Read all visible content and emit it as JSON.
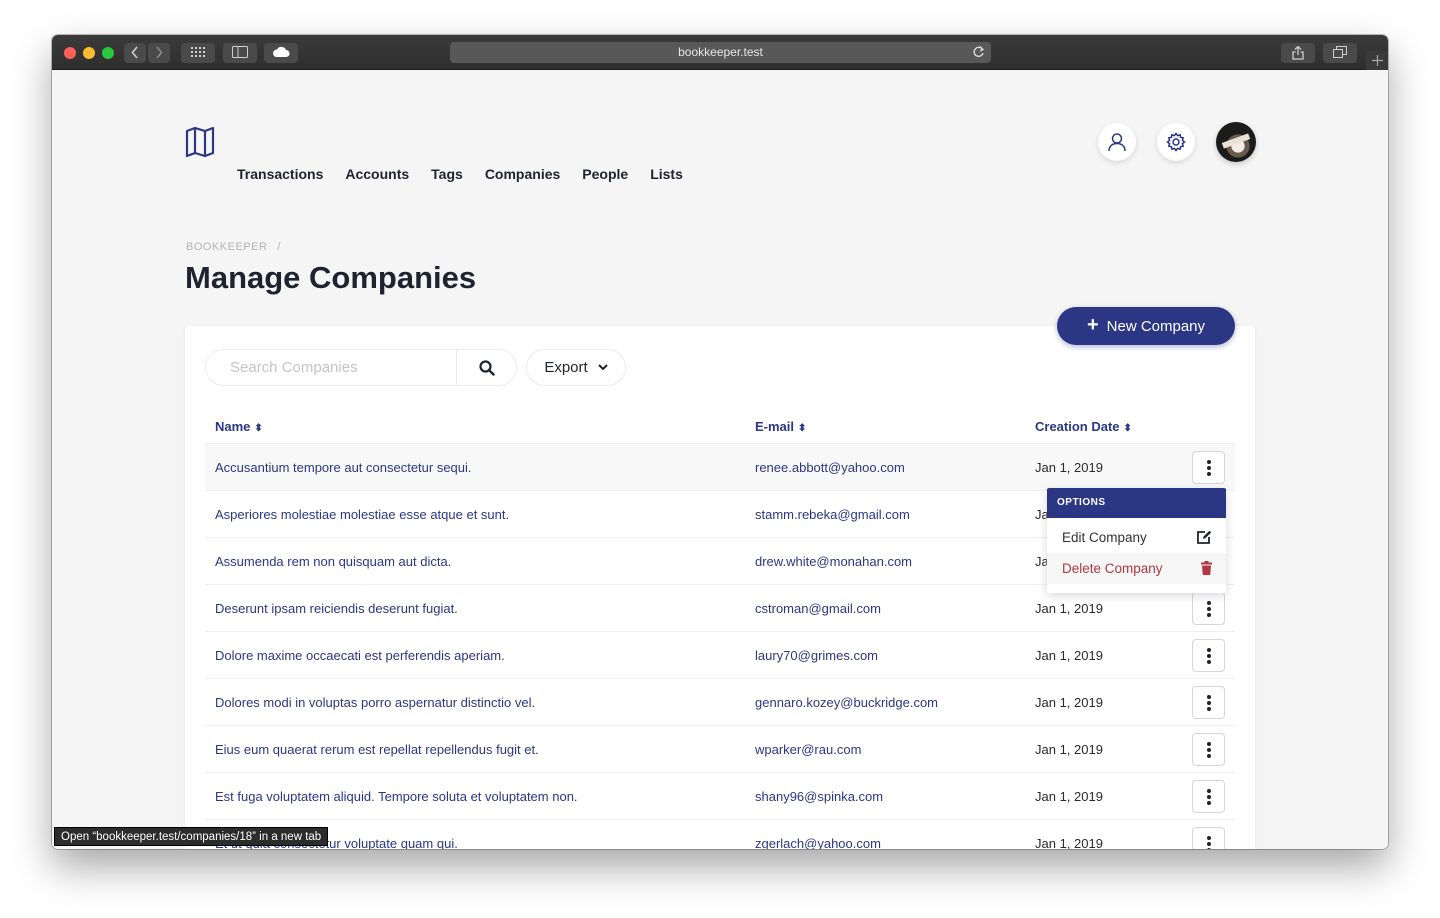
{
  "browser": {
    "url": "bookkeeper.test",
    "status_tip": "Open “bookkeeper.test/companies/18” in a new tab"
  },
  "nav": {
    "items": [
      "Transactions",
      "Accounts",
      "Tags",
      "Companies",
      "People",
      "Lists"
    ]
  },
  "breadcrumb": {
    "root": "BOOKKEEPER",
    "separator": "/"
  },
  "page": {
    "title": "Manage Companies",
    "new_button": "New Company"
  },
  "toolbar": {
    "search_placeholder": "Search Companies",
    "export_label": "Export"
  },
  "table": {
    "headers": {
      "name": "Name",
      "email": "E-mail",
      "created": "Creation Date"
    },
    "rows": [
      {
        "name": "Accusantium tempore aut consectetur sequi.",
        "email": "renee.abbott@yahoo.com",
        "date": "Jan 1, 2019"
      },
      {
        "name": "Asperiores molestiae molestiae esse atque et sunt.",
        "email": "stamm.rebeka@gmail.com",
        "date": "Ja"
      },
      {
        "name": "Assumenda rem non quisquam aut dicta.",
        "email": "drew.white@monahan.com",
        "date": "Ja"
      },
      {
        "name": "Deserunt ipsam reiciendis deserunt fugiat.",
        "email": "cstroman@gmail.com",
        "date": "Jan 1, 2019"
      },
      {
        "name": "Dolore maxime occaecati est perferendis aperiam.",
        "email": "laury70@grimes.com",
        "date": "Jan 1, 2019"
      },
      {
        "name": "Dolores modi in voluptas porro aspernatur distinctio vel.",
        "email": "gennaro.kozey@buckridge.com",
        "date": "Jan 1, 2019"
      },
      {
        "name": "Eius eum quaerat rerum est repellat repellendus fugit et.",
        "email": "wparker@rau.com",
        "date": "Jan 1, 2019"
      },
      {
        "name": "Est fuga voluptatem aliquid. Tempore soluta et voluptatem non.",
        "email": "shany96@spinka.com",
        "date": "Jan 1, 2019"
      },
      {
        "name": "Et ut quia consectetur voluptate quam qui.",
        "email": "zgerlach@yahoo.com",
        "date": "Jan 1, 2019"
      }
    ]
  },
  "dropdown": {
    "header": "OPTIONS",
    "edit": "Edit Company",
    "delete": "Delete Company"
  },
  "colors": {
    "accent": "#2b3784",
    "danger": "#b1383f"
  }
}
